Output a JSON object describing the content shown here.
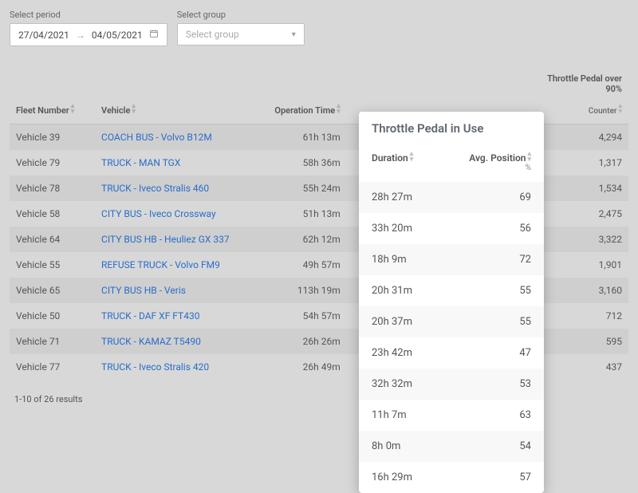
{
  "filters": {
    "period_label": "Select period",
    "date_from": "27/04/2021",
    "date_to": "04/05/2021",
    "group_label": "Select group",
    "group_placeholder": "Select group"
  },
  "columns": {
    "fleet": "Fleet Number",
    "vehicle": "Vehicle",
    "operation_time": "Operation Time",
    "throttle_group": "Throttle Pedal over 90%",
    "counter": "Counter"
  },
  "panel": {
    "title": "Throttle Pedal in Use",
    "duration": "Duration",
    "avg_position": "Avg. Position",
    "pct": "%"
  },
  "rows": [
    {
      "fleet": "Vehicle 39",
      "vehicle": "COACH BUS - Volvo B12M",
      "op": "61h 13m",
      "counter": "4,294"
    },
    {
      "fleet": "Vehicle 79",
      "vehicle": "TRUCK - MAN TGX",
      "op": "58h 36m",
      "counter": "1,317"
    },
    {
      "fleet": "Vehicle 78",
      "vehicle": "TRUCK - Iveco Stralis 460",
      "op": "55h 24m",
      "counter": "1,534"
    },
    {
      "fleet": "Vehicle 58",
      "vehicle": "CITY BUS - Iveco Crossway",
      "op": "51h 13m",
      "counter": "2,475"
    },
    {
      "fleet": "Vehicle 64",
      "vehicle": "CITY BUS HB - Heuliez GX 337",
      "op": "62h 12m",
      "counter": "3,322"
    },
    {
      "fleet": "Vehicle 55",
      "vehicle": "REFUSE TRUCK - Volvo FM9",
      "op": "49h 57m",
      "counter": "1,901"
    },
    {
      "fleet": "Vehicle 65",
      "vehicle": "CITY BUS HB - Veris",
      "op": "113h 19m",
      "counter": "3,160"
    },
    {
      "fleet": "Vehicle 50",
      "vehicle": "TRUCK - DAF XF FT430",
      "op": "54h 57m",
      "counter": "712"
    },
    {
      "fleet": "Vehicle 71",
      "vehicle": "TRUCK - KAMAZ T5490",
      "op": "26h 26m",
      "counter": "595"
    },
    {
      "fleet": "Vehicle 77",
      "vehicle": "TRUCK - Iveco Stralis 420",
      "op": "26h 49m",
      "counter": "437"
    }
  ],
  "throttle_rows": [
    {
      "duration": "28h 27m",
      "avg": "69"
    },
    {
      "duration": "33h 20m",
      "avg": "56"
    },
    {
      "duration": "18h 9m",
      "avg": "72"
    },
    {
      "duration": "20h 31m",
      "avg": "55"
    },
    {
      "duration": "20h 37m",
      "avg": "55"
    },
    {
      "duration": "23h 42m",
      "avg": "47"
    },
    {
      "duration": "32h 32m",
      "avg": "53"
    },
    {
      "duration": "11h 7m",
      "avg": "63"
    },
    {
      "duration": "8h 0m",
      "avg": "54"
    },
    {
      "duration": "16h 29m",
      "avg": "57"
    }
  ],
  "footer": {
    "results": "1-10 of 26 results"
  }
}
